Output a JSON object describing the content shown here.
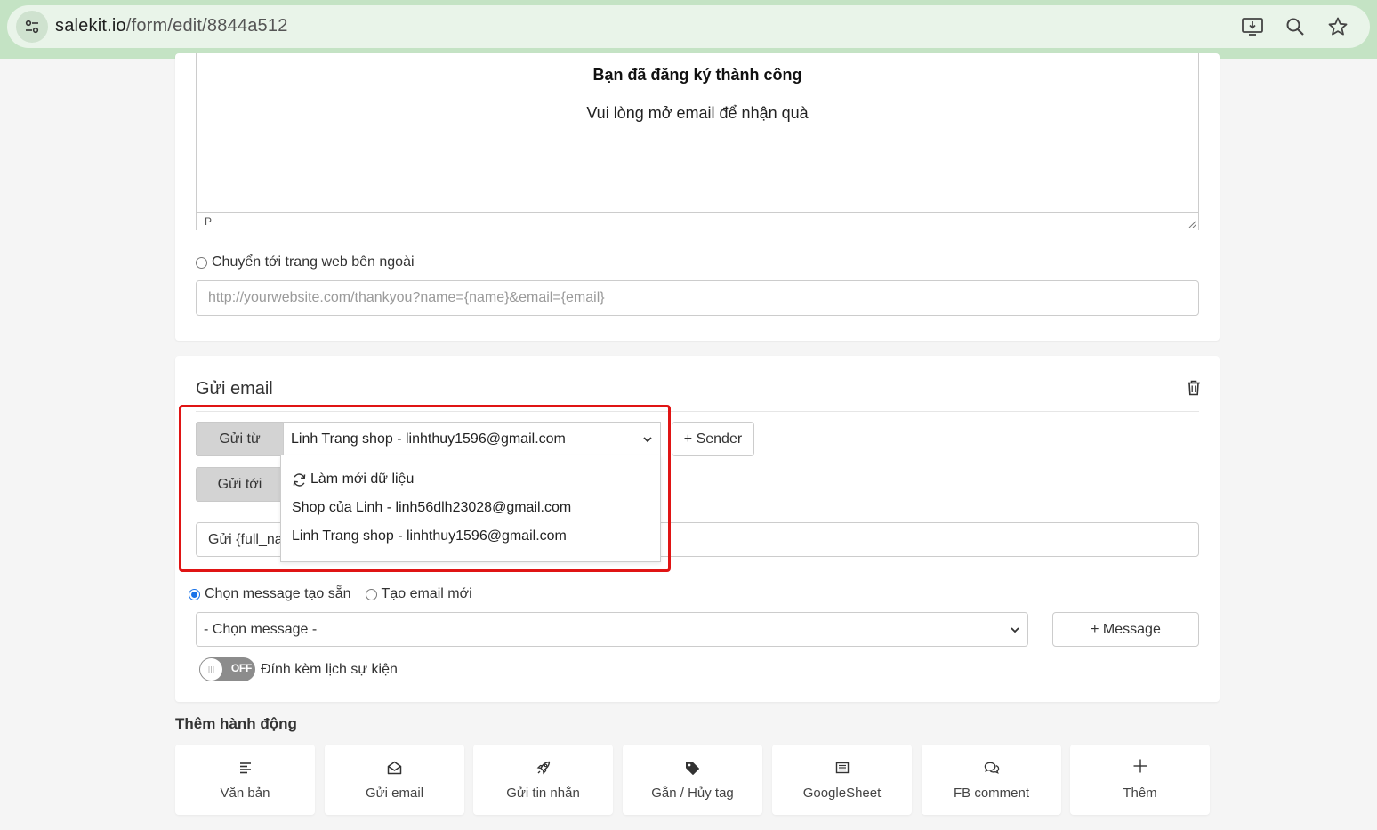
{
  "browser": {
    "url_host": "salekit.io",
    "url_path": "/form/edit/8844a512"
  },
  "thankyou": {
    "heading": "Bạn đã đăng ký thành công",
    "text": "Vui lòng mở email để nhận quà",
    "editor_status": "P",
    "redirect_label": "Chuyển tới trang web bên ngoài",
    "redirect_placeholder": "http://yourwebsite.com/thankyou?name={name}&email={email}"
  },
  "send_email": {
    "title": "Gửi email",
    "from_label": "Gửi từ",
    "from_value": "Linh Trang shop - linhthuy1596@gmail.com",
    "add_sender": "+ Sender",
    "to_label": "Gửi tới",
    "subject_value": "Gửi {full_na",
    "dropdown": {
      "refresh": "Làm mới dữ liệu",
      "options": [
        "Shop của Linh - linh56dlh23028@gmail.com",
        "Linh Trang shop - linhthuy1596@gmail.com"
      ]
    },
    "radio_preset": "Chọn message tạo sẵn",
    "radio_new": "Tạo email mới",
    "message_select": "- Chọn message -",
    "add_message": "+ Message",
    "toggle_state": "OFF",
    "toggle_label": "Đính kèm lịch sự kiện"
  },
  "actions": {
    "title": "Thêm hành động",
    "items": [
      {
        "label": "Văn bản",
        "icon": "text-lines-icon"
      },
      {
        "label": "Gửi email",
        "icon": "envelope-open-icon"
      },
      {
        "label": "Gửi tin nhắn",
        "icon": "rocket-icon"
      },
      {
        "label": "Gắn / Hủy tag",
        "icon": "tag-icon"
      },
      {
        "label": "GoogleSheet",
        "icon": "sheet-icon"
      },
      {
        "label": "FB comment",
        "icon": "comments-icon"
      },
      {
        "label": "Thêm",
        "icon": "plus-icon"
      }
    ]
  },
  "colors": {
    "browser_bar": "#c4e3c4",
    "highlight": "#e01414",
    "radio_checked": "#1a73e8"
  }
}
